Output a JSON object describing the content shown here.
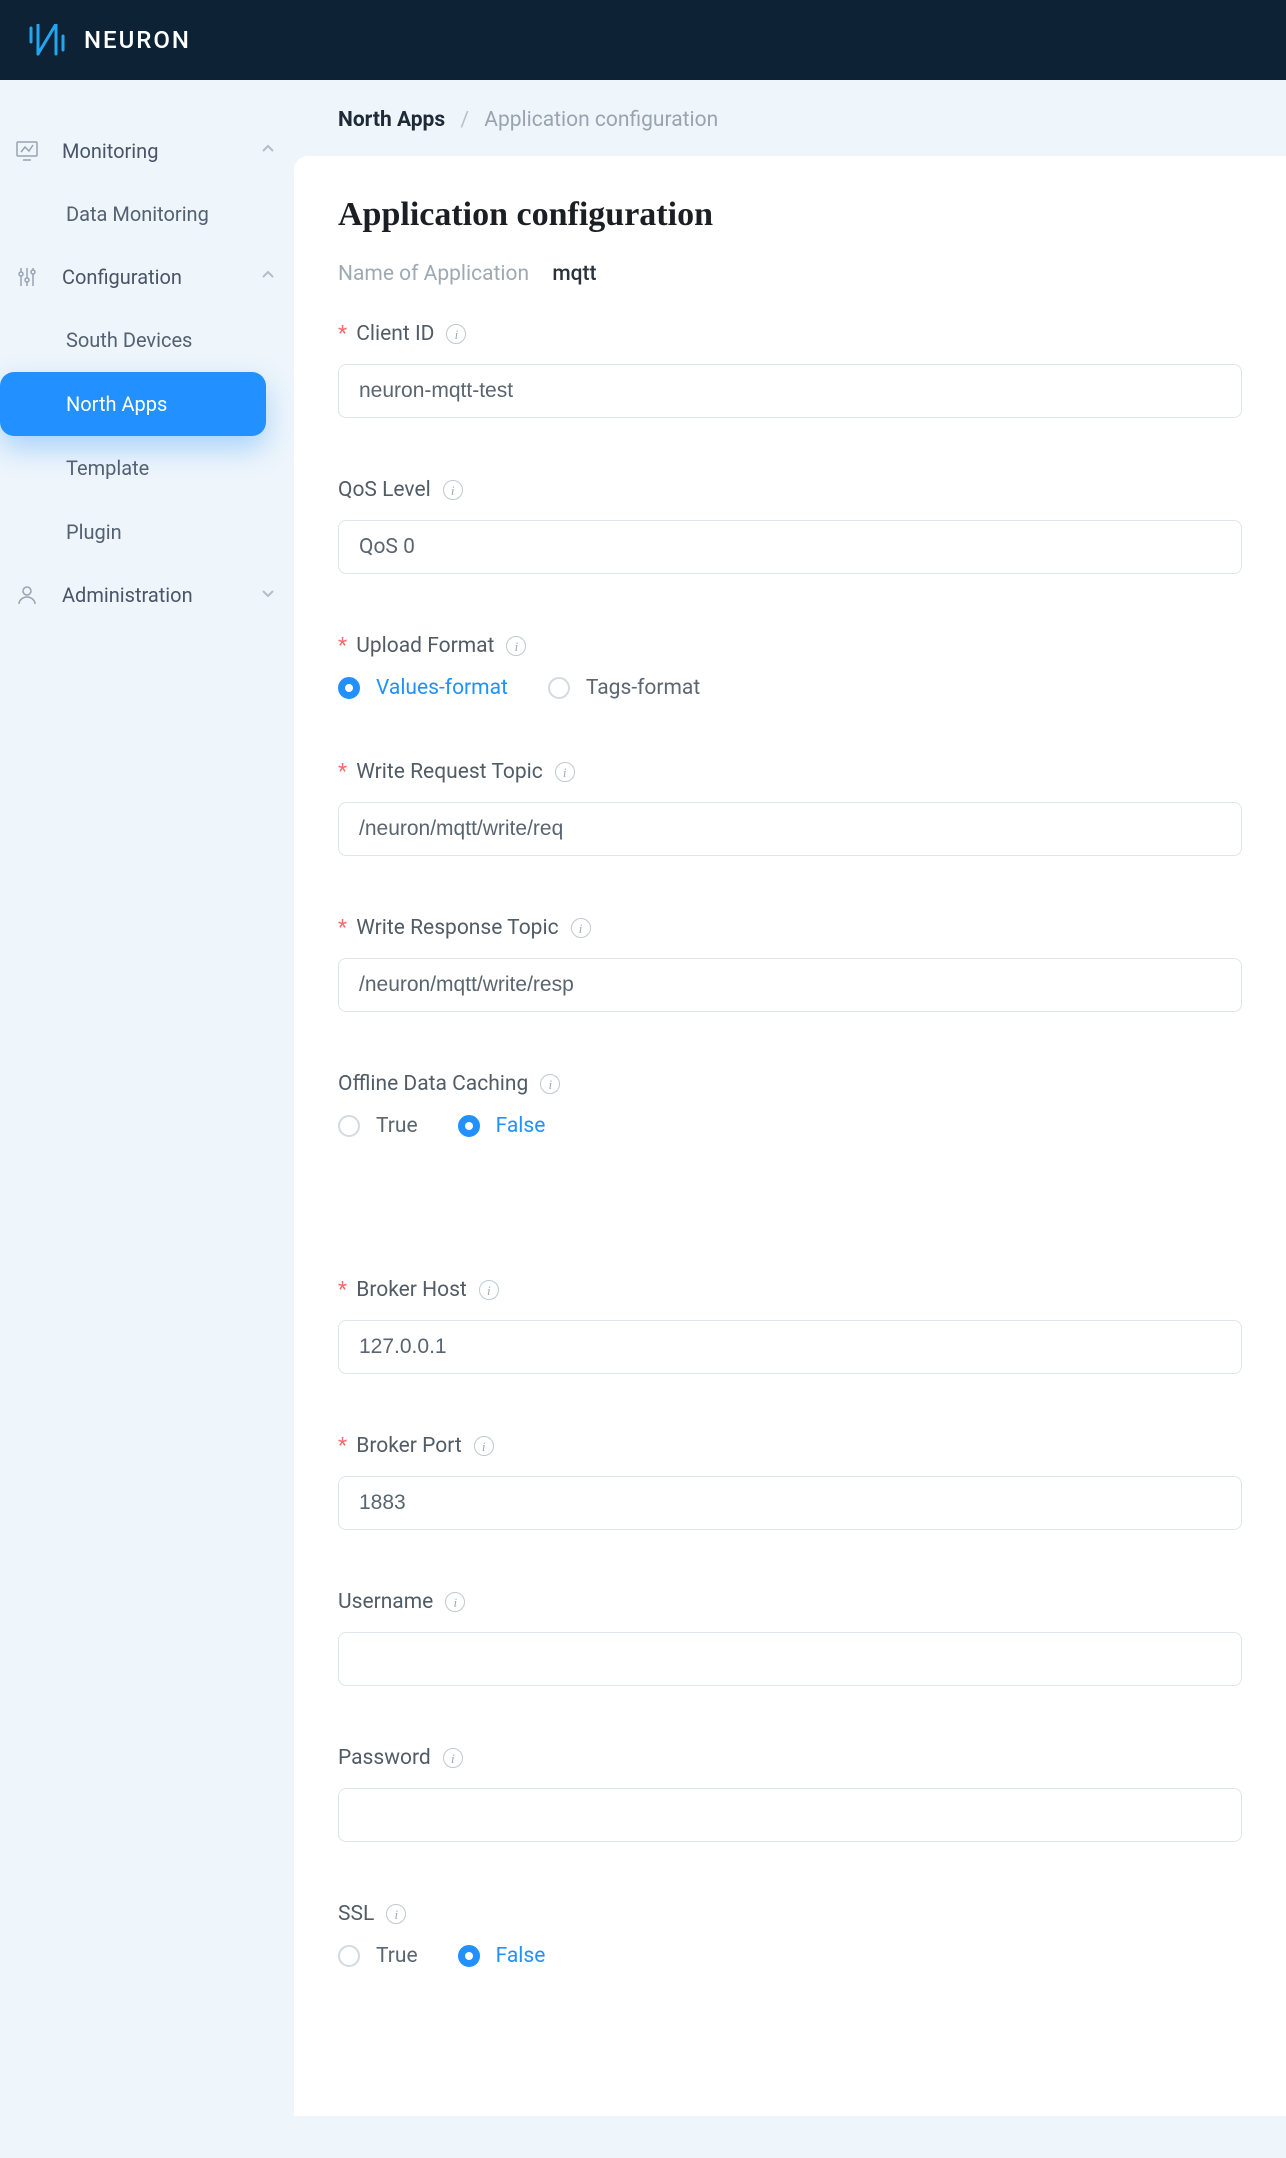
{
  "brand": "NEURON",
  "sidebar": {
    "monitoring": {
      "label": "Monitoring",
      "items": [
        {
          "label": "Data Monitoring"
        }
      ]
    },
    "configuration": {
      "label": "Configuration",
      "items": [
        {
          "label": "South Devices"
        },
        {
          "label": "North Apps"
        },
        {
          "label": "Template"
        },
        {
          "label": "Plugin"
        }
      ]
    },
    "administration": {
      "label": "Administration"
    }
  },
  "breadcrumb": {
    "a": "North Apps",
    "b": "Application configuration"
  },
  "page": {
    "title": "Application configuration",
    "appNameLabel": "Name of Application",
    "appName": "mqtt"
  },
  "form": {
    "clientId": {
      "label": "Client ID",
      "value": "neuron-mqtt-test",
      "required": true
    },
    "qos": {
      "label": "QoS Level",
      "value": "QoS 0",
      "required": false
    },
    "uploadFormat": {
      "label": "Upload Format",
      "required": true,
      "options": [
        {
          "label": "Values-format"
        },
        {
          "label": "Tags-format"
        }
      ],
      "selected": "Values-format"
    },
    "writeReq": {
      "label": "Write Request Topic",
      "value": "/neuron/mqtt/write/req",
      "required": true
    },
    "writeResp": {
      "label": "Write Response Topic",
      "value": "/neuron/mqtt/write/resp",
      "required": true
    },
    "offlineCache": {
      "label": "Offline Data Caching",
      "required": false,
      "options": [
        {
          "label": "True"
        },
        {
          "label": "False"
        }
      ],
      "selected": "False"
    },
    "brokerHost": {
      "label": "Broker Host",
      "value": "127.0.0.1",
      "required": true
    },
    "brokerPort": {
      "label": "Broker Port",
      "value": "1883",
      "required": true
    },
    "username": {
      "label": "Username",
      "value": "",
      "required": false
    },
    "password": {
      "label": "Password",
      "value": "",
      "required": false
    },
    "ssl": {
      "label": "SSL",
      "required": false,
      "options": [
        {
          "label": "True"
        },
        {
          "label": "False"
        }
      ],
      "selected": "False"
    }
  }
}
